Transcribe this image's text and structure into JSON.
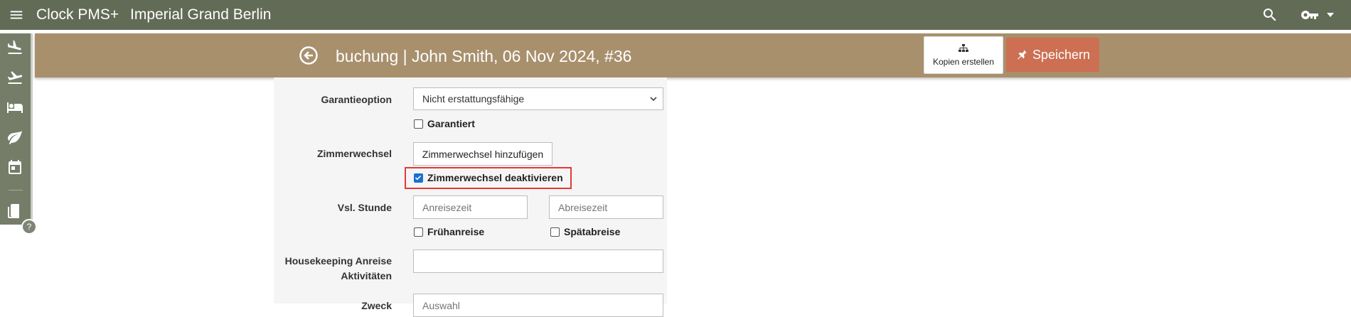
{
  "app": {
    "brand": "Clock PMS+",
    "hotel": "Imperial Grand Berlin"
  },
  "header": {
    "title": "buchung | John Smith, 06 Nov 2024, #36",
    "copy_label": "Kopien erstellen",
    "save_label": "Speichern"
  },
  "rail": {
    "icons": [
      "flight-land-icon",
      "flight-takeoff-icon",
      "bed-icon",
      "leaf-icon",
      "calendar-icon",
      "book-icon"
    ],
    "help": "?"
  },
  "form": {
    "guarantee": {
      "label": "Garantieoption",
      "value": "Nicht erstattungsfähige",
      "checkbox_label": "Garantiert",
      "checked": false
    },
    "room_change": {
      "label": "Zimmerwechsel",
      "add_button": "Zimmerwechsel hinzufügen",
      "disable_label": "Zimmerwechsel deaktivieren",
      "disable_checked": true
    },
    "eta": {
      "label": "Vsl. Stunde",
      "arrival_placeholder": "Anreisezeit",
      "departure_placeholder": "Abreisezeit",
      "early_label": "Frühanreise",
      "late_label": "Spätabreise"
    },
    "housekeeping": {
      "label_line1": "Housekeeping Anreise",
      "label_line2": "Aktivitäten",
      "value": ""
    },
    "next": {
      "label": "Zweck",
      "placeholder": "Auswahl"
    }
  },
  "colors": {
    "topbar": "#626b56",
    "subbar": "#a8906d",
    "save": "#cd6f52",
    "highlight": "#e53935",
    "check": "#1a6fd4"
  }
}
